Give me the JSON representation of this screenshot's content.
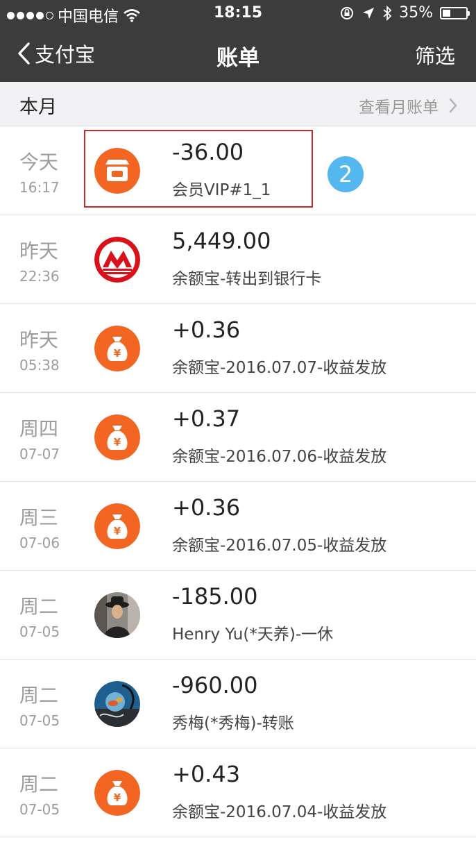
{
  "status_bar": {
    "carrier": "中国电信",
    "time": "18:15",
    "battery": "35%",
    "battery_level": 0.35
  },
  "nav": {
    "back_label": "支付宝",
    "title": "账单",
    "filter_label": "筛选"
  },
  "section": {
    "month_label": "本月",
    "monthly_bill_link": "查看月账单"
  },
  "annotation": {
    "badge": "2"
  },
  "transactions": [
    {
      "day": "今天",
      "time": "16:17",
      "amount": "-36.00",
      "desc": "会员VIP#1_1",
      "icon": "shop-icon"
    },
    {
      "day": "昨天",
      "time": "22:36",
      "amount": "5,449.00",
      "desc": "余额宝-转出到银行卡",
      "icon": "bank-logo-icon"
    },
    {
      "day": "昨天",
      "time": "05:38",
      "amount": "+0.36",
      "desc": "余额宝-2016.07.07-收益发放",
      "icon": "money-bag-icon"
    },
    {
      "day": "周四",
      "time": "07-07",
      "amount": "+0.37",
      "desc": "余额宝-2016.07.06-收益发放",
      "icon": "money-bag-icon"
    },
    {
      "day": "周三",
      "time": "07-06",
      "amount": "+0.36",
      "desc": "余额宝-2016.07.05-收益发放",
      "icon": "money-bag-icon"
    },
    {
      "day": "周二",
      "time": "07-05",
      "amount": "-185.00",
      "desc": "Henry Yu(*天养)-一休",
      "icon": "avatar-photo"
    },
    {
      "day": "周二",
      "time": "07-05",
      "amount": "-960.00",
      "desc": "秀梅(*秀梅)-转账",
      "icon": "avatar-photo"
    },
    {
      "day": "周二",
      "time": "07-05",
      "amount": "+0.43",
      "desc": "余额宝-2016.07.04-收益发放",
      "icon": "money-bag-icon"
    }
  ],
  "colors": {
    "topbar": "#3c3c3c",
    "accent_orange": "#f26522",
    "badge_blue": "#55b7f0",
    "highlight_red": "#cc2a2a"
  }
}
